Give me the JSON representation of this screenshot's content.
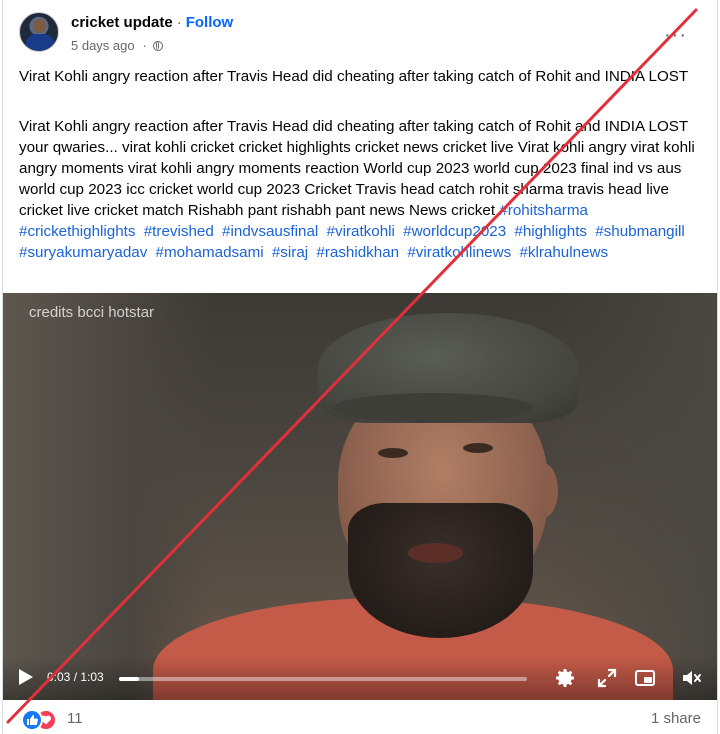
{
  "post": {
    "page_name": "cricket update",
    "separator": "·",
    "follow_label": "Follow",
    "timestamp": "5 days ago",
    "meta_separator": "·",
    "more_label": "···",
    "title": "Virat Kohli angry reaction after Travis Head did cheating after taking catch of Rohit and INDIA LOST",
    "description": "Virat Kohli angry reaction after Travis Head did cheating after taking catch of Rohit and INDIA LOST your qwaries... virat kohli cricket cricket highlights cricket news cricket live Virat kohli angry virat kohli angry moments virat kohli angry moments reaction World cup 2023 world cup 2023 final ind vs aus world cup 2023 icc cricket world cup 2023 Cricket Travis head catch rohit sharma travis head live cricket live cricket match Rishabh pant rishabh pant news News cricket",
    "hashtags": [
      "#rohitsharma",
      "#crickethighlights",
      "#trevished",
      "#indvsausfinal",
      "#viratkohli",
      "#worldcup2023",
      "#highlights",
      "#shubmangill",
      "#suryakumaryadav",
      "#mohamadsami",
      "#siraj",
      "#rashidkhan",
      "#viratkohlinews",
      "#klrahulnews"
    ]
  },
  "video": {
    "credits": "credits bcci hotstar",
    "time": "0:03 / 1:03",
    "progress": 0.05
  },
  "footer": {
    "reaction_count": "11",
    "share_count": "1 share"
  },
  "icons": [
    "avatar",
    "globe-icon",
    "more-icon",
    "play-icon",
    "gear-icon",
    "fullscreen-icon",
    "pip-icon",
    "mute-icon",
    "like-icon",
    "love-icon"
  ],
  "colors": {
    "follow": "#0866ff",
    "hashtag": "#1a63d6",
    "strike": "#e0303a",
    "like": "#1877f2",
    "love": "#f33e58"
  }
}
